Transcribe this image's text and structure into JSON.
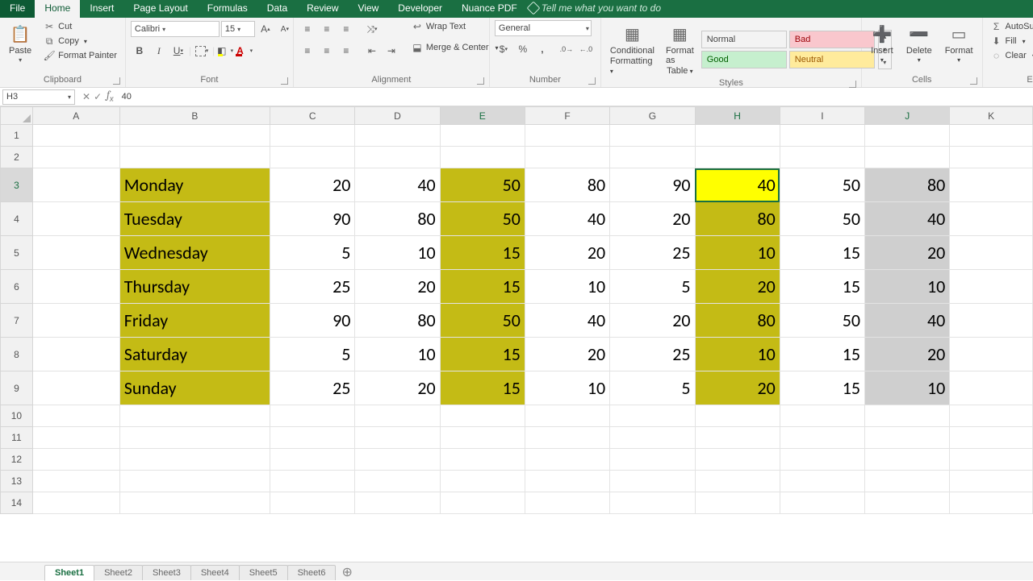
{
  "tabs": {
    "file": "File",
    "home": "Home",
    "insert": "Insert",
    "pageLayout": "Page Layout",
    "formulas": "Formulas",
    "data": "Data",
    "review": "Review",
    "view": "View",
    "developer": "Developer",
    "nuance": "Nuance PDF",
    "tell": "Tell me what you want to do"
  },
  "clipboard": {
    "paste": "Paste",
    "cut": "Cut",
    "copy": "Copy",
    "formatPainter": "Format Painter",
    "title": "Clipboard"
  },
  "font": {
    "name": "Calibri",
    "size": "15",
    "incFont": "A▲",
    "decFont": "A▼",
    "bold": "B",
    "italic": "I",
    "underline": "U",
    "title": "Font"
  },
  "alignment": {
    "wrap": "Wrap Text",
    "merge": "Merge & Center",
    "title": "Alignment"
  },
  "number": {
    "format": "General",
    "title": "Number"
  },
  "styles": {
    "cond": "Conditional",
    "cond2": "Formatting",
    "fmt": "Format as",
    "fmt2": "Table",
    "normal": "Normal",
    "bad": "Bad",
    "good": "Good",
    "neutral": "Neutral",
    "title": "Styles"
  },
  "cells": {
    "insert": "Insert",
    "delete": "Delete",
    "format": "Format",
    "title": "Cells"
  },
  "editing": {
    "autosum": "AutoSum",
    "fill": "Fill",
    "clear": "Clear",
    "title": "Editi"
  },
  "nameBox": "H3",
  "formulaValue": "40",
  "columns": [
    "A",
    "B",
    "C",
    "D",
    "E",
    "F",
    "G",
    "H",
    "I",
    "J",
    "K"
  ],
  "rowNumbers": [
    "1",
    "2",
    "3",
    "4",
    "5",
    "6",
    "7",
    "8",
    "9",
    "10",
    "11",
    "12",
    "13",
    "14"
  ],
  "data": {
    "rows": [
      {
        "day": "Monday",
        "v": [
          20,
          40,
          50,
          80,
          90,
          40,
          50,
          80
        ]
      },
      {
        "day": "Tuesday",
        "v": [
          90,
          80,
          50,
          40,
          20,
          80,
          50,
          40
        ]
      },
      {
        "day": "Wednesday",
        "v": [
          5,
          10,
          15,
          20,
          25,
          10,
          15,
          20
        ]
      },
      {
        "day": "Thursday",
        "v": [
          25,
          20,
          15,
          10,
          5,
          20,
          15,
          10
        ]
      },
      {
        "day": "Friday",
        "v": [
          90,
          80,
          50,
          40,
          20,
          80,
          50,
          40
        ]
      },
      {
        "day": "Saturday",
        "v": [
          5,
          10,
          15,
          20,
          25,
          10,
          15,
          20
        ]
      },
      {
        "day": "Sunday",
        "v": [
          25,
          20,
          15,
          10,
          5,
          20,
          15,
          10
        ]
      }
    ]
  },
  "sheets": [
    "Sheet1",
    "Sheet2",
    "Sheet3",
    "Sheet4",
    "Sheet5",
    "Sheet6"
  ]
}
